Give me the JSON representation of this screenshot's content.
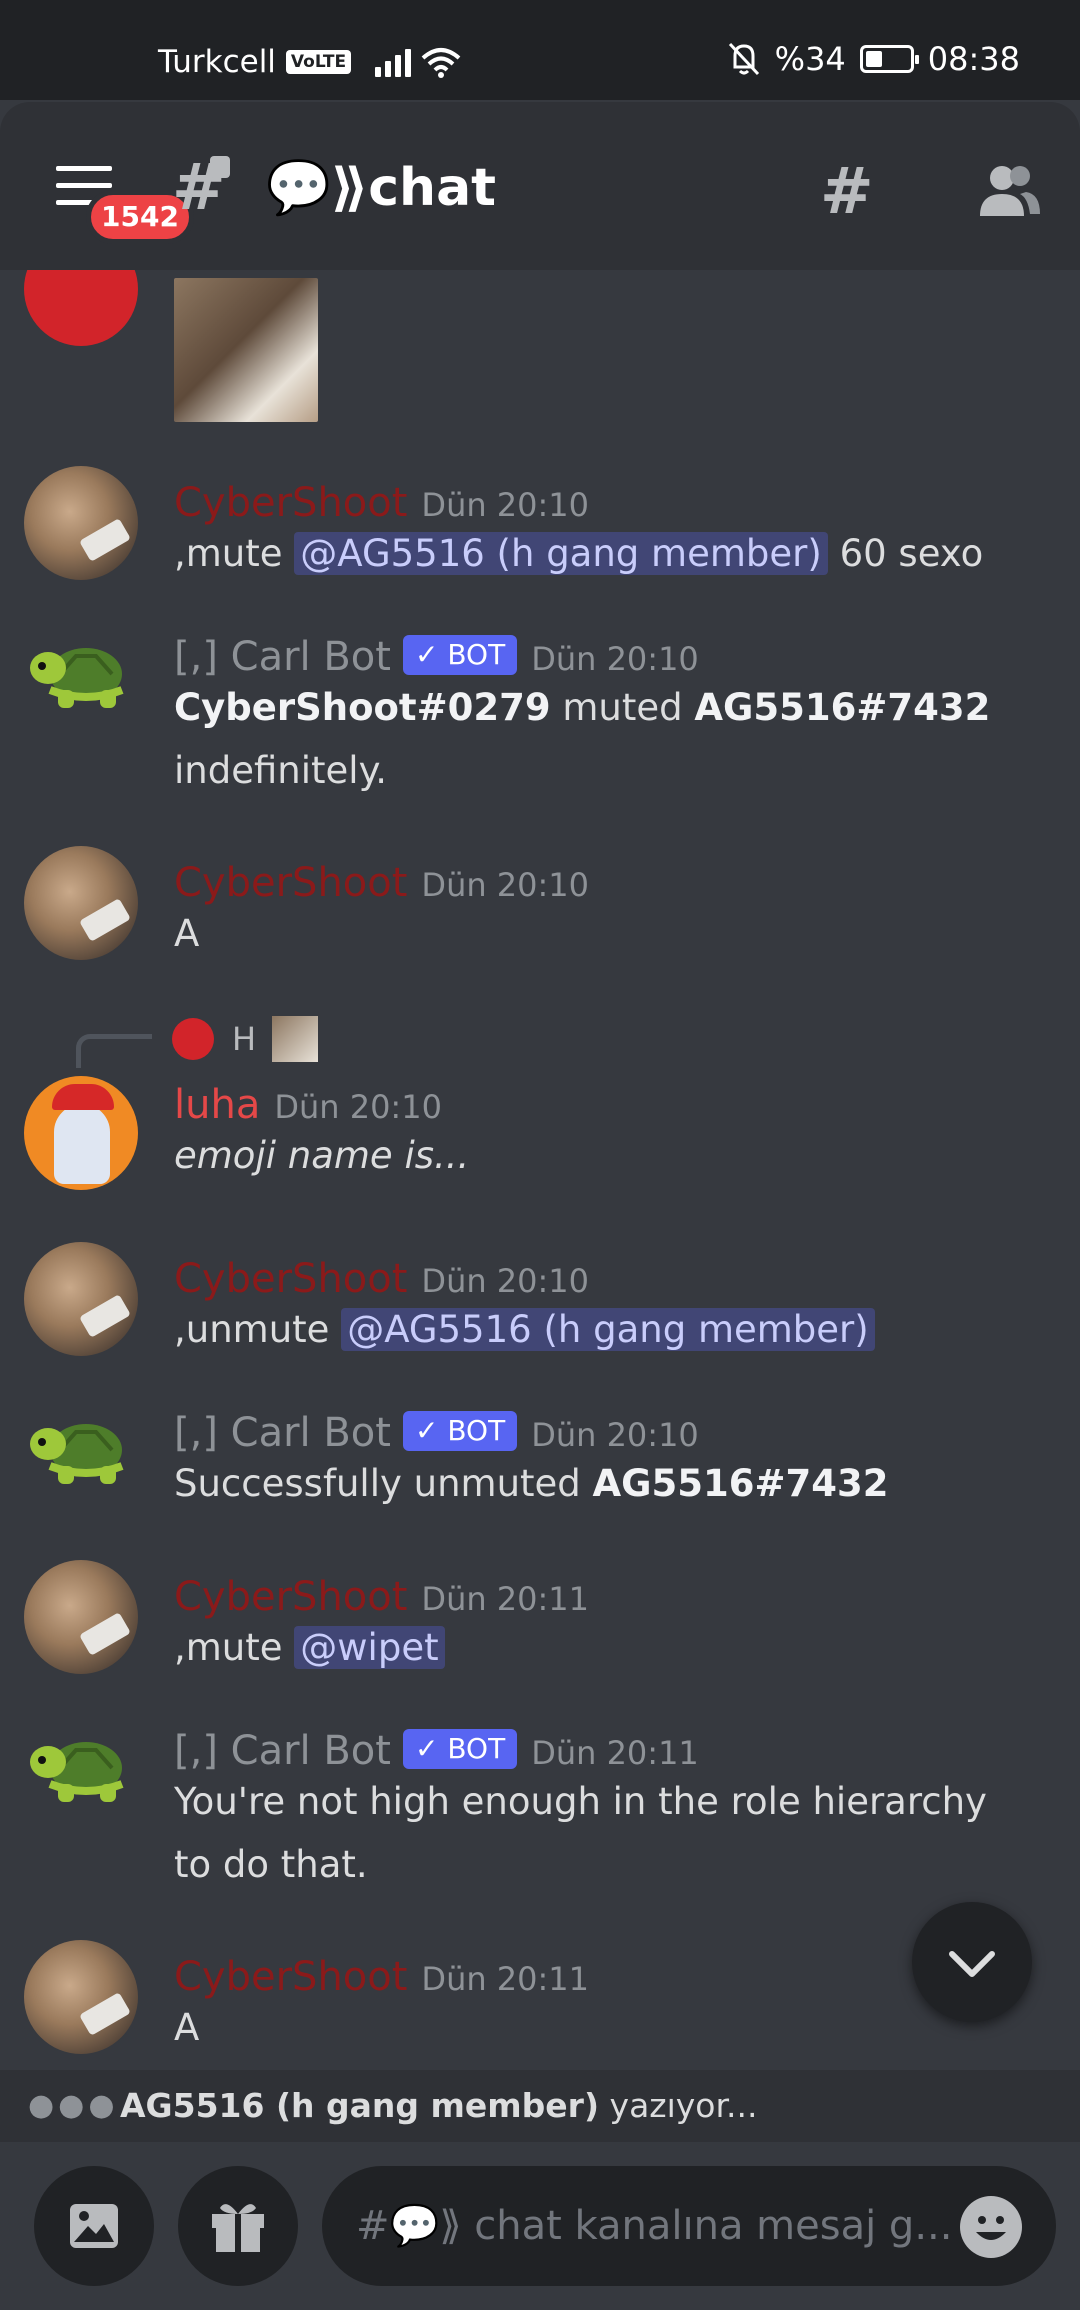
{
  "status_bar": {
    "carrier": "Turkcell",
    "volte": "VoLTE",
    "battery": "%34",
    "time": "08:38"
  },
  "header": {
    "unread_badge": "1542",
    "channel_name": "💬⟫chat"
  },
  "messages": [
    {
      "author": "CyberShoot",
      "time": "Dün 20:10",
      "pre": ",mute ",
      "mention": "@AG5516 (h gang member)",
      "post": "  60 sexo"
    },
    {
      "author": "[,] Carl Bot",
      "bot": "✓ BOT",
      "time": "Dün 20:10",
      "b1": "CyberShoot#0279",
      "mid": " muted ",
      "b2": "AG5516#7432",
      "post": " indefinitely."
    },
    {
      "author": "CyberShoot",
      "time": "Dün 20:10",
      "text": "A"
    },
    {
      "reply_name": "H",
      "author": "luha",
      "time": "Dün 20:10",
      "text": "emoji name is..."
    },
    {
      "author": "CyberShoot",
      "time": "Dün 20:10",
      "pre": ",unmute ",
      "mention": "@AG5516 (h gang member)"
    },
    {
      "author": "[,] Carl Bot",
      "bot": "✓ BOT",
      "time": "Dün 20:10",
      "pre": "Successfully unmuted ",
      "b1": "AG5516#7432"
    },
    {
      "author": "CyberShoot",
      "time": "Dün 20:11",
      "pre": ",mute ",
      "mention": "@wipet"
    },
    {
      "author": "[,] Carl Bot",
      "bot": "✓ BOT",
      "time": "Dün 20:11",
      "text": "You're not high enough in the role hierarchy to do that."
    },
    {
      "author": "CyberShoot",
      "time": "Dün 20:11",
      "text": "A"
    }
  ],
  "typing": {
    "user": "AG5516 (h gang member)",
    "suffix": " yazıyor..."
  },
  "composer": {
    "placeholder": "#💬⟫ chat kanalına mesaj g..."
  },
  "colors": {
    "background": "#36393f",
    "header": "#2f3136",
    "bot_badge": "#5865f2",
    "mention_bg": "#414675",
    "unread_badge": "#ed4245"
  }
}
